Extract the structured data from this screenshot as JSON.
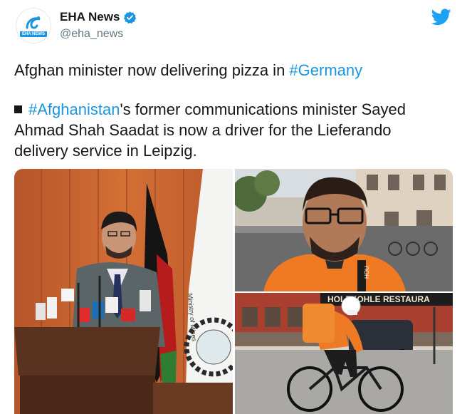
{
  "author": {
    "name": "EHA News",
    "handle": "@eha_news",
    "avatar_text": "EHA NEWS"
  },
  "tweet": {
    "headline_prefix": "Afghan minister now delivering pizza in ",
    "headline_hashtag": "#Germany",
    "para_hashtag": "#Afghanistan",
    "para_rest_1": "'s former communications minister Sayed",
    "para_line_2": "Ahmad Shah Saadat is now a driver for the Lieferando",
    "para_line_3": "delivery service in Leipzig."
  },
  "images": {
    "restaurant_sign": "HOLZKOHLE RESTAURA",
    "shirt_text": "HOU",
    "seal_text": "Ministry of Mines"
  },
  "colors": {
    "accent": "#1b95e0",
    "text": "#14171a",
    "secondary": "#657786"
  },
  "icons": {
    "verified": "verified-badge-icon",
    "bird": "twitter-bird-icon",
    "bullet": "square-bullet-icon"
  }
}
